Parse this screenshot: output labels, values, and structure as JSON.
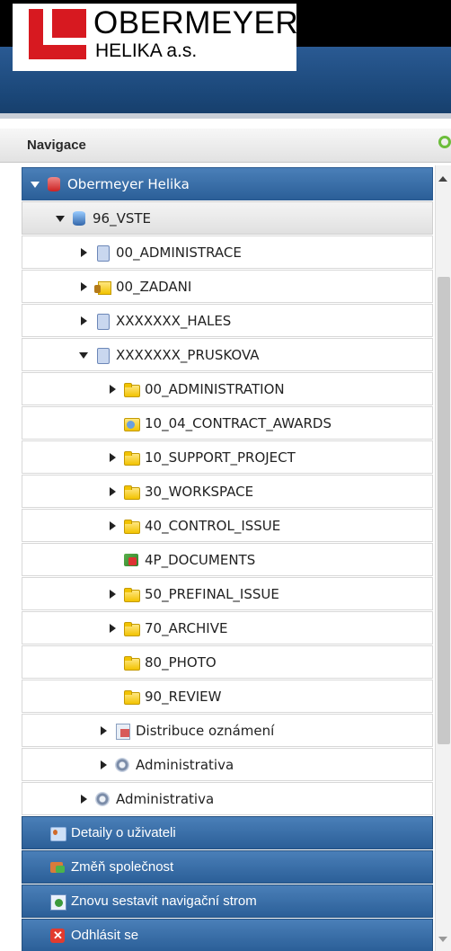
{
  "brand": {
    "name": "OBERMEYER",
    "subtitle": "HELIKA a.s.",
    "color": "#d71920"
  },
  "panel": {
    "title": "Navigace"
  },
  "tree": [
    {
      "label": "Obermeyer Helika",
      "icon": "database-red-icon",
      "expanded": true
    },
    {
      "label": "96_VSTE",
      "icon": "database-blue-icon",
      "expanded": true
    },
    {
      "label": "00_ADMINISTRACE",
      "icon": "project-icon",
      "expanded": false
    },
    {
      "label": "00_ZADANI",
      "icon": "locked-folder-icon",
      "expanded": false
    },
    {
      "label": "XXXXXXX_HALES",
      "icon": "project-icon",
      "expanded": false
    },
    {
      "label": "XXXXXXX_PRUSKOVA",
      "icon": "project-icon",
      "expanded": true
    },
    {
      "label": "00_ADMINISTRATION",
      "icon": "folder-icon",
      "expanded": false
    },
    {
      "label": "10_04_CONTRACT_AWARDS",
      "icon": "award-folder-icon",
      "expanded": null
    },
    {
      "label": "10_SUPPORT_PROJECT",
      "icon": "folder-icon",
      "expanded": false
    },
    {
      "label": "30_WORKSPACE",
      "icon": "folder-icon",
      "expanded": false
    },
    {
      "label": "40_CONTROL_ISSUE",
      "icon": "folder-icon",
      "expanded": false
    },
    {
      "label": "4P_DOCUMENTS",
      "icon": "4p-documents-icon",
      "expanded": null
    },
    {
      "label": "50_PREFINAL_ISSUE",
      "icon": "folder-icon",
      "expanded": false
    },
    {
      "label": "70_ARCHIVE",
      "icon": "folder-icon",
      "expanded": false
    },
    {
      "label": "80_PHOTO",
      "icon": "folder-icon",
      "expanded": null
    },
    {
      "label": "90_REVIEW",
      "icon": "folder-icon",
      "expanded": null
    },
    {
      "label": "Distribuce oznámení",
      "icon": "distribution-icon",
      "expanded": false
    },
    {
      "label": "Administrativa",
      "icon": "gear-icon",
      "expanded": false
    },
    {
      "label": "Administrativa",
      "icon": "gear-icon",
      "expanded": false
    }
  ],
  "bottom_menu": [
    {
      "label": "Detaily o uživateli",
      "icon": "user-details-icon"
    },
    {
      "label": "Změň společnost",
      "icon": "change-company-icon"
    },
    {
      "label": "Znovu sestavit navigační strom",
      "icon": "rebuild-tree-icon"
    },
    {
      "label": "Odhlásit se",
      "icon": "logout-icon"
    }
  ]
}
